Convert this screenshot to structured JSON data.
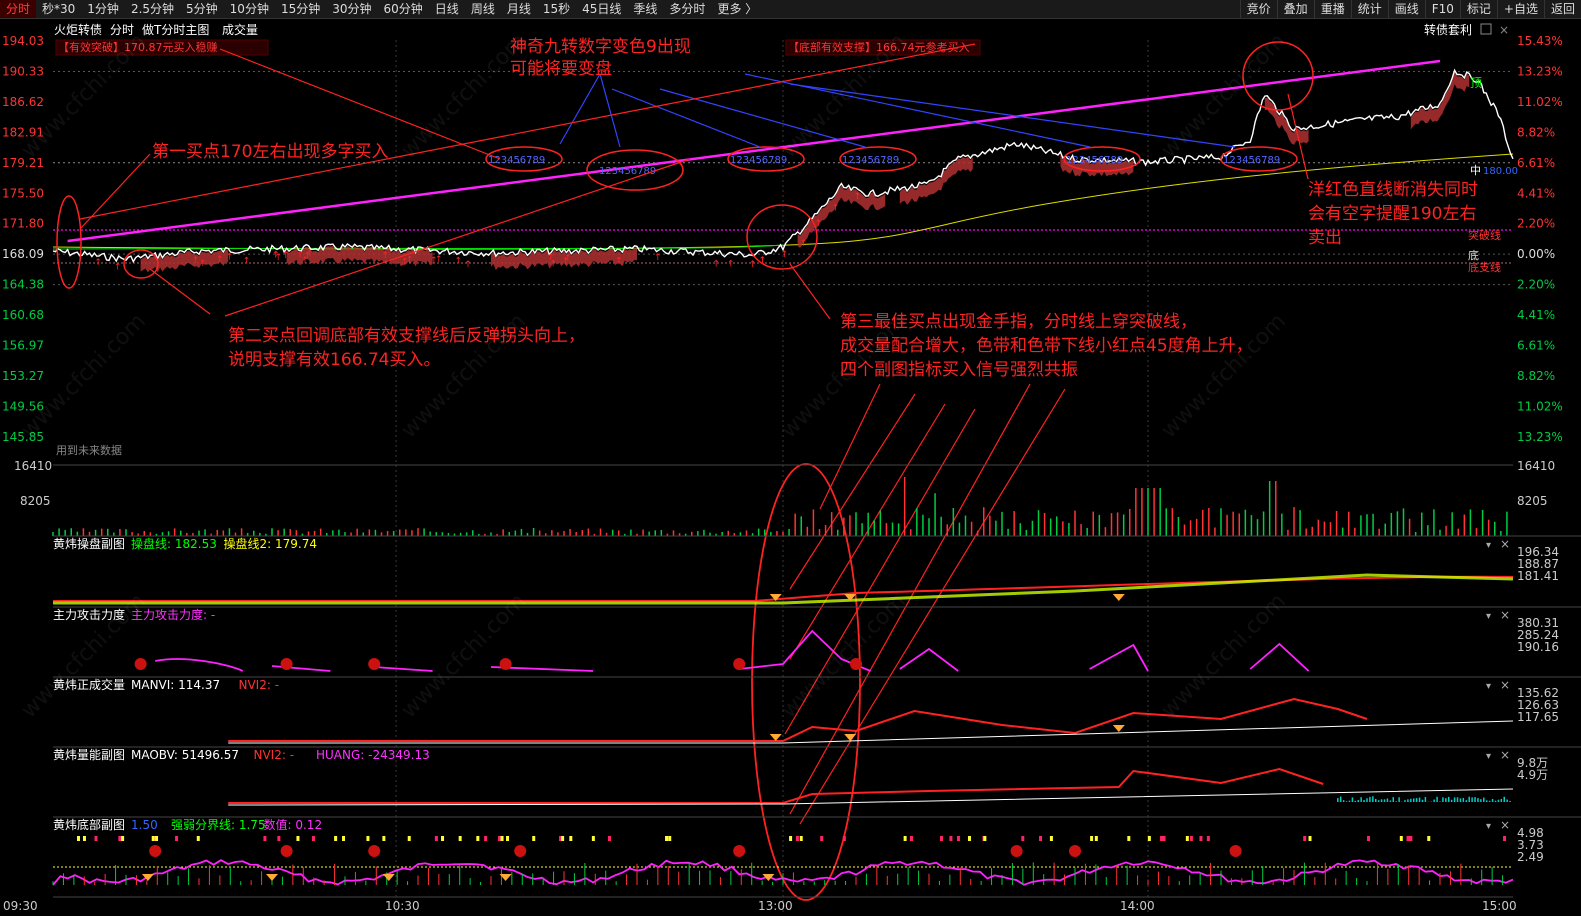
{
  "toolbar": {
    "left_tabs": [
      "分时",
      "秒*30",
      "1分钟",
      "2.5分钟",
      "5分钟",
      "10分钟",
      "15分钟",
      "30分钟",
      "60分钟",
      "日线",
      "周线",
      "月线",
      "15秒",
      "45日线",
      "季线",
      "多分时",
      "更多 〉"
    ],
    "active_tab": "分时",
    "right_tabs": [
      "竞价",
      "叠加",
      "重播",
      "统计",
      "画线",
      "F10",
      "标记",
      "+自选",
      "返回"
    ]
  },
  "header": {
    "stock_name": "火炬转债",
    "modes": [
      "分时",
      "做T分时主图",
      "成交量"
    ],
    "right_label": "转债套利"
  },
  "price_axis": {
    "left": [
      "194.03",
      "190.33",
      "186.62",
      "182.91",
      "179.21",
      "175.50",
      "171.80",
      "168.09",
      "164.38",
      "160.68",
      "156.97",
      "153.27",
      "149.56",
      "145.85"
    ],
    "right": [
      "15.43%",
      "13.23%",
      "11.02%",
      "8.82%",
      "6.61%",
      "4.41%",
      "2.20%",
      "0.00%",
      "2.20%",
      "4.41%",
      "6.61%",
      "8.82%",
      "11.02%",
      "13.23%"
    ]
  },
  "volume_axis": {
    "left": [
      "16410",
      "8205"
    ],
    "right": [
      "16410",
      "8205"
    ]
  },
  "time_axis": [
    "09:30",
    "10:30",
    "13:00",
    "14:00",
    "15:00"
  ],
  "chart_labels": {
    "top_label": "顶",
    "breakout_line": "突破线",
    "bottom_label": "底",
    "bottom_support": "底支线",
    "mid_label": "中",
    "mid_value": "180.00",
    "future_data": "用到未来数据",
    "effective_breakout": "【有效突破】170.87元买入稳赚",
    "bottom_support_note": "【底部有效支撑】166.74元参考买入",
    "nine_seq": "123456789"
  },
  "annotations": {
    "a1": "神奇九转数字变色9出现",
    "a2": "可能将要变盘",
    "a3": "第一买点170左右出现多字买入",
    "a4": "第二买点回调底部有效支撑线后反弹拐头向上，",
    "a5": "说明支撑有效166.74买入。",
    "a6": "第三最佳买点出现金手指，分时线上穿突破线，",
    "a7": "成交量配合增大，色带和色带下线小红点45度角上升，",
    "a8": "四个副图指标买入信号强烈共振",
    "a9": "洋红色直线断消失同时",
    "a10": "会有空字提醒190左右",
    "a11": "卖出"
  },
  "sub_panels": [
    {
      "title": "黄炜操盘副图",
      "items": [
        {
          "label": "操盘线: 182.53",
          "color": "#00ff00"
        },
        {
          "label": "操盘线2: 179.74",
          "color": "#ffff00"
        }
      ],
      "axis": [
        "196.34",
        "188.87",
        "181.41"
      ]
    },
    {
      "title": "主力攻击力度",
      "items": [
        {
          "label": "主力攻击力度: -",
          "color": "#ff33ff"
        }
      ],
      "axis": [
        "380.31",
        "285.24",
        "190.16"
      ]
    },
    {
      "title": "黄炜正成交量",
      "items": [
        {
          "label": "MANVI: 114.37",
          "color": "#ffffff"
        },
        {
          "label": "NVI2: -",
          "color": "#ff3333"
        }
      ],
      "axis": [
        "135.62",
        "126.63",
        "117.65"
      ]
    },
    {
      "title": "黄炜量能副图",
      "items": [
        {
          "label": "MAOBV: 51496.57",
          "color": "#ffffff"
        },
        {
          "label": "NVI2: -",
          "color": "#ff3333"
        },
        {
          "label": "HUANG: -24349.13",
          "color": "#ff33ff"
        }
      ],
      "axis": [
        "9.8万",
        "4.9万"
      ]
    },
    {
      "title": "黄炜底部副图",
      "items": [
        {
          "label": "1.50",
          "color": "#3366ff"
        },
        {
          "label": "强弱分界线: 1.75",
          "color": "#00ff00"
        },
        {
          "label": "数值: 0.12",
          "color": "#ff33ff"
        }
      ],
      "axis": [
        "4.98",
        "3.73",
        "2.49"
      ]
    }
  ],
  "watermark": "www.cfchi.com",
  "colors": {
    "up": "#ff2222",
    "down": "#00cc00",
    "magenta": "#ff00ff",
    "price": "#ffffff",
    "avg": "#ffff00",
    "band": "#cc3333"
  }
}
